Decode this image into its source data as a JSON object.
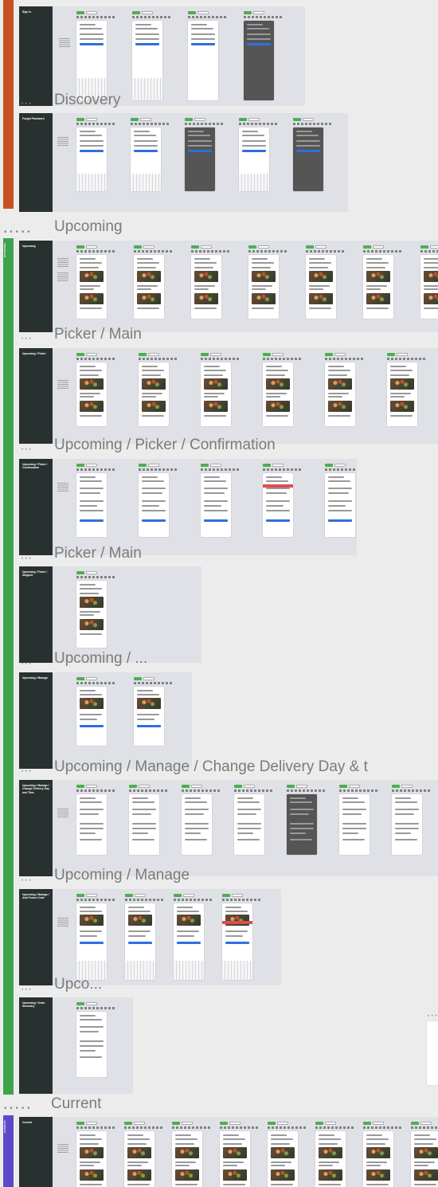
{
  "colors": {
    "canvas_bg": "#ececec",
    "group_bg": "#dfe1e6",
    "label_col": "#293130",
    "bar_orange": "#c8501f",
    "bar_green": "#3fa34d",
    "bar_purple": "#5b49c9",
    "tag_green": "#4caf50",
    "accent_blue": "#2f6fde",
    "error_red": "#e04b52"
  },
  "canvas": {
    "bars": [
      {
        "name": "auth",
        "label": "",
        "color": "#c8501f"
      },
      {
        "name": "upcoming",
        "label": "UPCOMING",
        "color": "#3fa34d"
      },
      {
        "name": "current",
        "label": "CURRENT",
        "color": "#5b49c9"
      }
    ],
    "overflow_titles": [
      {
        "text": "Discovery"
      },
      {
        "text": "Upcoming"
      },
      {
        "text": "Picker / Main"
      },
      {
        "text": "Upcoming / Picker / Confirmation"
      },
      {
        "text": "Picker / Main"
      },
      {
        "text": "Upcoming / ..."
      },
      {
        "text": "Upcoming / Manage / Change Delivery Day & t"
      },
      {
        "text": "Upcoming / Manage"
      },
      {
        "text": "Upco..."
      },
      {
        "text": "Current"
      }
    ],
    "dots": "• • • • •",
    "small_dots": "• • •"
  },
  "groups": [
    {
      "name": "sign-in",
      "label": "Sign In",
      "frames": 4
    },
    {
      "name": "forgot-password",
      "label": "Forgot Password",
      "frames": 5
    },
    {
      "name": "upcoming",
      "label": "Upcoming",
      "frames": 8
    },
    {
      "name": "upcoming-picker",
      "label": "Upcoming / Picker",
      "frames": 7
    },
    {
      "name": "upcoming-picker-confirmation",
      "label": "Upcoming / Picker / Confirmation",
      "frames": 5
    },
    {
      "name": "upcoming-picker-skipped",
      "label": "Upcoming / Picker / Skipped",
      "frames": 1
    },
    {
      "name": "upcoming-manage",
      "label": "Upcoming / Manage",
      "frames": 2
    },
    {
      "name": "upcoming-manage-change-delivery",
      "label": "Upcoming / Manage / Change Delivery Day and Time",
      "frames": 7
    },
    {
      "name": "upcoming-manage-add-promo",
      "label": "Upcoming / Manage / Add Promo Code",
      "frames": 4
    },
    {
      "name": "upcoming-order-summary",
      "label": "Upcoming / Order Summary",
      "frames": 1
    },
    {
      "name": "current",
      "label": "Current",
      "frames": 8
    }
  ]
}
